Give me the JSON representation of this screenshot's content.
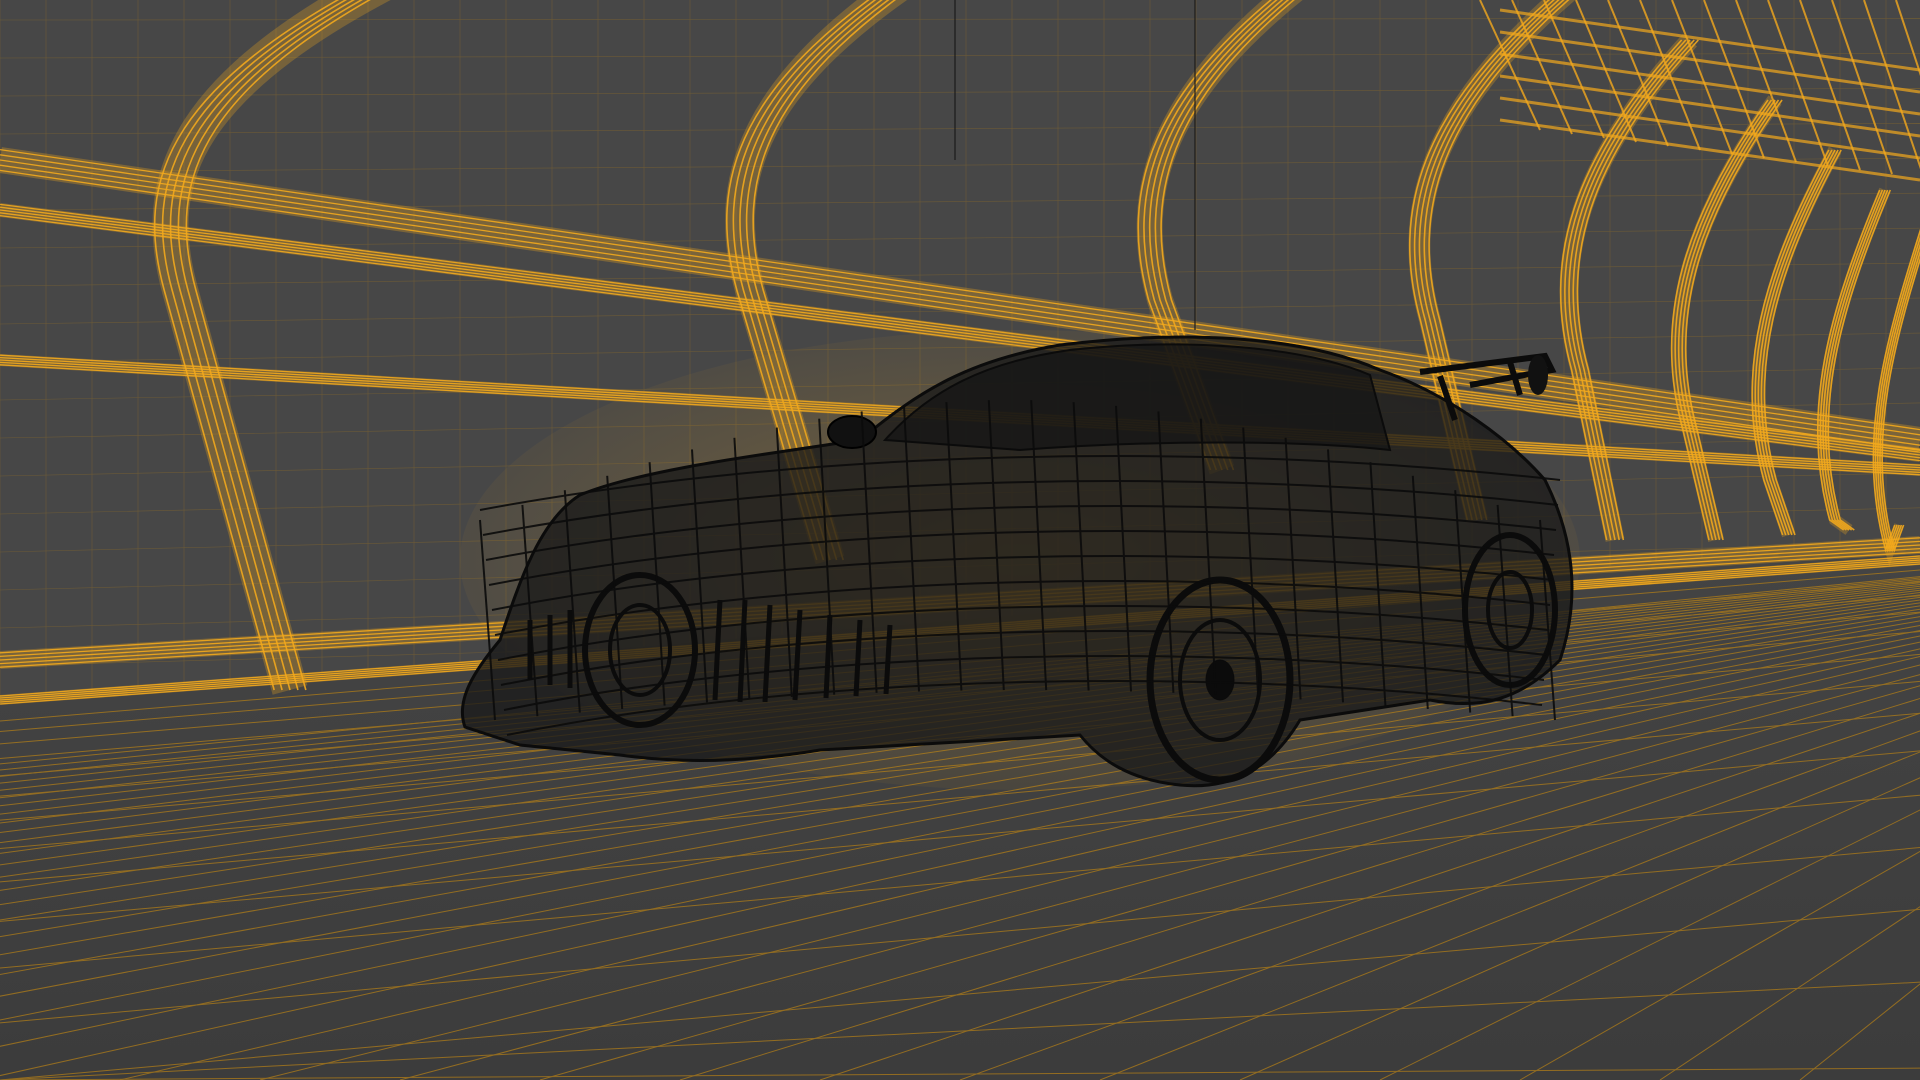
{
  "scene": {
    "subject": "car",
    "render_style": "wireframe",
    "environment": "arched tunnel",
    "colors": {
      "background": "#474747",
      "floor": "#3f3f3f",
      "tunnel_wire": "#f2a81d",
      "tunnel_wire_dim": "#b07d18",
      "car_wire": "#0b0b0b",
      "car_fill": "#1a1a1a",
      "grid": "#c08a1e"
    }
  }
}
